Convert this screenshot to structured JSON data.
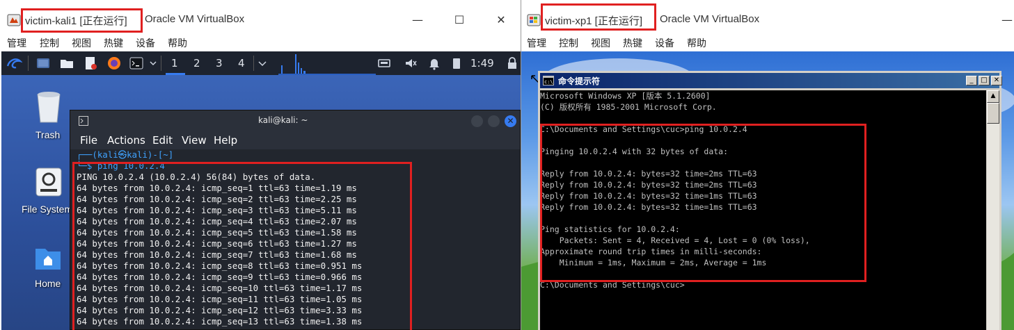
{
  "left_window": {
    "vm_name": "victim-kali1 [正在运行]",
    "app_name": "Oracle VM VirtualBox",
    "menu": [
      "管理",
      "控制",
      "视图",
      "热键",
      "设备",
      "帮助"
    ],
    "panel": {
      "workspaces": [
        "1",
        "2",
        "3",
        "4"
      ],
      "clock": "1:49"
    },
    "desktop_icons": [
      "Trash",
      "File System",
      "Home"
    ],
    "terminal": {
      "title": "kali@kali: ~",
      "menu": [
        "File",
        "Actions",
        "Edit",
        "View",
        "Help"
      ],
      "prompt_line1": "┌──(kali㉿kali)-[~]",
      "prompt_line2": "└─$ ping 10.0.2.4",
      "output": [
        "PING 10.0.2.4 (10.0.2.4) 56(84) bytes of data.",
        "64 bytes from 10.0.2.4: icmp_seq=1 ttl=63 time=1.19 ms",
        "64 bytes from 10.0.2.4: icmp_seq=2 ttl=63 time=2.25 ms",
        "64 bytes from 10.0.2.4: icmp_seq=3 ttl=63 time=5.11 ms",
        "64 bytes from 10.0.2.4: icmp_seq=4 ttl=63 time=2.07 ms",
        "64 bytes from 10.0.2.4: icmp_seq=5 ttl=63 time=1.58 ms",
        "64 bytes from 10.0.2.4: icmp_seq=6 ttl=63 time=1.27 ms",
        "64 bytes from 10.0.2.4: icmp_seq=7 ttl=63 time=1.68 ms",
        "64 bytes from 10.0.2.4: icmp_seq=8 ttl=63 time=0.951 ms",
        "64 bytes from 10.0.2.4: icmp_seq=9 ttl=63 time=0.966 ms",
        "64 bytes from 10.0.2.4: icmp_seq=10 ttl=63 time=1.17 ms",
        "64 bytes from 10.0.2.4: icmp_seq=11 ttl=63 time=1.05 ms",
        "64 bytes from 10.0.2.4: icmp_seq=12 ttl=63 time=3.33 ms",
        "64 bytes from 10.0.2.4: icmp_seq=13 ttl=63 time=1.38 ms"
      ]
    }
  },
  "right_window": {
    "vm_name": "victim-xp1 [正在运行]",
    "app_name": "Oracle VM VirtualBox",
    "menu": [
      "管理",
      "控制",
      "视图",
      "热键",
      "设备",
      "帮助"
    ],
    "cmd": {
      "title": "命令提示符",
      "lines": [
        "Microsoft Windows XP [版本 5.1.2600]",
        "(C) 版权所有 1985-2001 Microsoft Corp.",
        "",
        "C:\\Documents and Settings\\cuc>ping 10.0.2.4",
        "",
        "Pinging 10.0.2.4 with 32 bytes of data:",
        "",
        "Reply from 10.0.2.4: bytes=32 time=2ms TTL=63",
        "Reply from 10.0.2.4: bytes=32 time=2ms TTL=63",
        "Reply from 10.0.2.4: bytes=32 time=1ms TTL=63",
        "Reply from 10.0.2.4: bytes=32 time=1ms TTL=63",
        "",
        "Ping statistics for 10.0.2.4:",
        "    Packets: Sent = 4, Received = 4, Lost = 0 (0% loss),",
        "Approximate round trip times in milli-seconds:",
        "    Minimum = 1ms, Maximum = 2ms, Average = 1ms",
        "",
        "C:\\Documents and Settings\\cuc>"
      ]
    }
  },
  "colors": {
    "highlight_red": "#e02020",
    "kali_blue": "#367bf0",
    "xp_title_blue": "#0a246a"
  }
}
